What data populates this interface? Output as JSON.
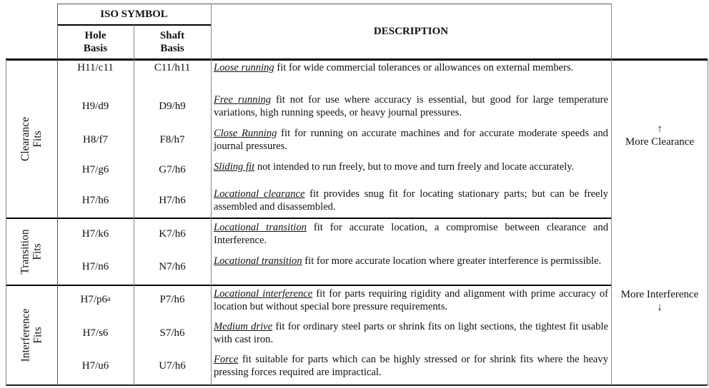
{
  "header": {
    "iso_symbol": "ISO SYMBOL",
    "hole_basis": [
      "Hole",
      "Basis"
    ],
    "shaft_basis": [
      "Shaft",
      "Basis"
    ],
    "description": "DESCRIPTION"
  },
  "groups": [
    {
      "name_line1": "Clearance",
      "name_line2": "Fits"
    },
    {
      "name_line1": "Transition",
      "name_line2": "Fits"
    },
    {
      "name_line1": "Interference",
      "name_line2": "Fits"
    }
  ],
  "rows": [
    {
      "hole": "H11/c11",
      "hole_sup": "",
      "shaft": "C11/h11",
      "term": "Loose running",
      "text": " fit for wide commercial tolerances or allowances on external members."
    },
    {
      "hole": "H9/d9",
      "hole_sup": "",
      "shaft": "D9/h9",
      "term": "Free running",
      "text": " fit not for use where accuracy is essential, but good for large temperature variations, high running speeds, or heavy journal pressures."
    },
    {
      "hole": "H8/f7",
      "hole_sup": "",
      "shaft": "F8/h7",
      "term": "Close Running",
      "text": " fit for running on accurate machines and for accurate moderate speeds and journal pressures."
    },
    {
      "hole": "H7/g6",
      "hole_sup": "",
      "shaft": "G7/h6",
      "term": "Sliding fit",
      "text": " not intended to run freely, but to move and turn freely and locate accurately."
    },
    {
      "hole": "H7/h6",
      "hole_sup": "",
      "shaft": "H7/h6",
      "term": "Locational clearance",
      "text": " fit provides snug fit for locating stationary parts; but can be freely assembled and disassembled."
    },
    {
      "hole": "H7/k6",
      "hole_sup": "",
      "shaft": "K7/h6",
      "term": "Locational transition",
      "text": " fit for accurate location, a compromise between clearance and Interference."
    },
    {
      "hole": "H7/n6",
      "hole_sup": "",
      "shaft": "N7/h6",
      "term": "Locational transition",
      "text": " fit for more accurate location where greater interference is permissible."
    },
    {
      "hole": "H7/p6",
      "hole_sup": "a",
      "shaft": "P7/h6",
      "term": "Locational interference",
      "text": " fit for parts requiring rigidity and alignment with prime accuracy of location but without special bore pressure requirements."
    },
    {
      "hole": "H7/s6",
      "hole_sup": "",
      "shaft": "S7/h6",
      "term": "Medium drive",
      "text": " fit for ordinary steel parts or shrink fits on light sections, the tightest fit usable with cast iron."
    },
    {
      "hole": "H7/u6",
      "hole_sup": "",
      "shaft": "U7/h6",
      "term": "Force",
      "text": " fit suitable for parts which can be highly stressed or for shrink fits where the heavy pressing forces required are impractical."
    }
  ],
  "trend": {
    "up_arrow": "↑",
    "more_clearance": "More Clearance",
    "more_interference": "More Interference",
    "down_arrow": "↓"
  }
}
